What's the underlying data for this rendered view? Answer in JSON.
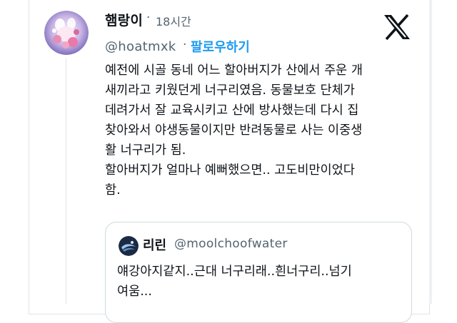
{
  "tweet": {
    "display_name": "햄랑이",
    "separator": "·",
    "time": "18시간",
    "handle": "@hoatmxk",
    "follow_separator": "·",
    "follow_label": "팔로우하기",
    "platform_icon": "x-logo-icon",
    "text_lines": [
      "예전에 시골 동네 어느 할아버지가 산에서 주운 개",
      "새끼라고 키웠던게 너구리였음. 동물보호 단체가",
      "데려가서 잘 교육시키고 산에 방사했는데 다시 집",
      "찾아와서 야생동물이지만 반려동물로 사는 이중생",
      "활 너구리가 됨.",
      "할아버지가 얼마나 예뻐했으면.. 고도비만이었다",
      "함."
    ]
  },
  "quoted_tweet": {
    "display_name": "리린",
    "handle": "@moolchoofwater",
    "text_lines": [
      "얘강아지같지..근대 너구리래..흰너구리..넘기",
      "여움..."
    ]
  },
  "colors": {
    "text": "#0f1419",
    "secondary": "#536471",
    "accent": "#1d9bf0",
    "border": "#cfd9de"
  }
}
